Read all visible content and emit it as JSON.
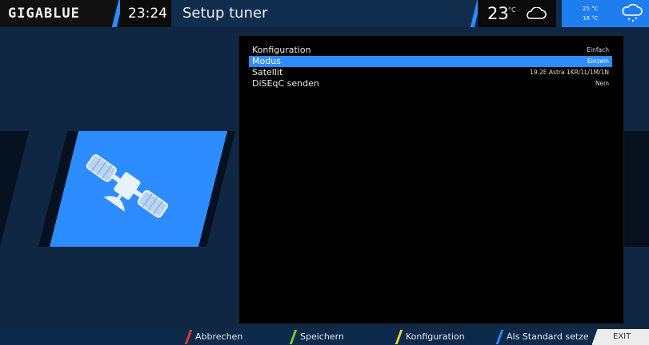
{
  "header": {
    "logo": "GIGABLUE",
    "clock": "23:24",
    "title": "Setup tuner",
    "temperature": "23",
    "temperature_unit": "°C",
    "weather_icon": "cloud-icon",
    "forecast_high": "25 °C",
    "forecast_low": "16 °C",
    "forecast_icon": "rain-cloud-icon"
  },
  "panel_icon": "satellite-icon",
  "settings": {
    "rows": [
      {
        "label": "Konfiguration",
        "value": "Einfach",
        "selected": false
      },
      {
        "label": "Modus",
        "value": "Einzeln",
        "selected": true
      },
      {
        "label": "Satellit",
        "value": "19.2E Astra 1KR/1L/1M/1N",
        "selected": false
      },
      {
        "label": "DiSEqC senden",
        "value": "Nein",
        "selected": false
      }
    ]
  },
  "footer": {
    "red_label": "Abbrechen",
    "green_label": "Speichern",
    "yellow_label": "Konfiguration",
    "blue_label": "Als Standard setzen",
    "exit_label": "EXIT"
  },
  "colors": {
    "accent": "#2d8cff",
    "red": "#e53935",
    "green": "#7ccc2e",
    "yellow": "#e6d23a",
    "blue": "#2d8cff"
  }
}
